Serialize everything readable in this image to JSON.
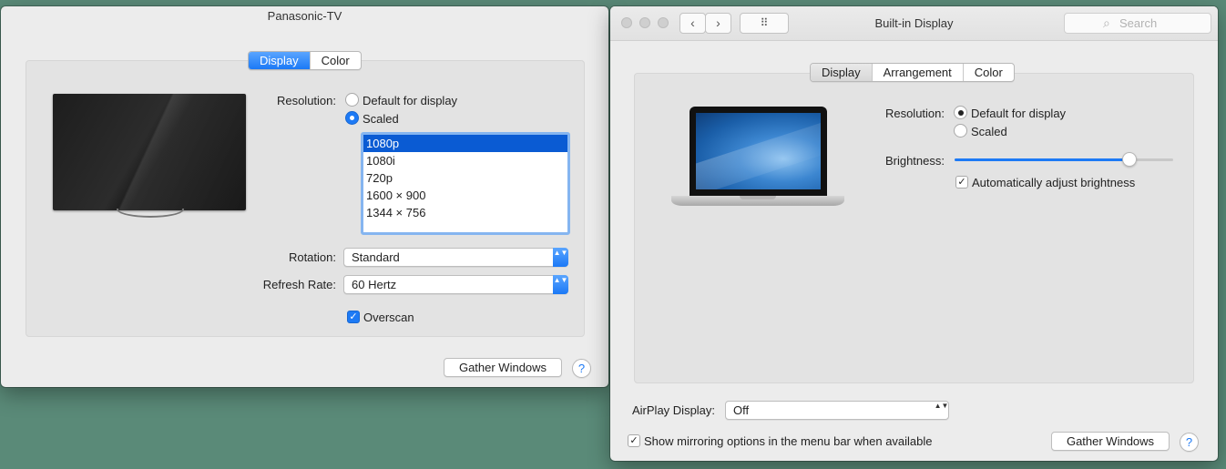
{
  "tv_window": {
    "title": "Panasonic-TV",
    "tabs": [
      {
        "label": "Display",
        "active": true
      },
      {
        "label": "Color",
        "active": false
      }
    ],
    "resolution_label": "Resolution:",
    "resolution_options": [
      {
        "label": "Default for display",
        "selected": false
      },
      {
        "label": "Scaled",
        "selected": true
      }
    ],
    "scaled_list": [
      {
        "label": "1080p",
        "selected": true
      },
      {
        "label": "1080i",
        "selected": false
      },
      {
        "label": "720p",
        "selected": false
      },
      {
        "label": "1600 × 900",
        "selected": false
      },
      {
        "label": "1344 × 756",
        "selected": false
      }
    ],
    "rotation_label": "Rotation:",
    "rotation_value": "Standard",
    "refresh_label": "Refresh Rate:",
    "refresh_value": "60 Hertz",
    "overscan_label": "Overscan",
    "overscan_checked": true,
    "gather_button": "Gather Windows",
    "help_glyph": "?"
  },
  "builtin_window": {
    "title": "Built-in Display",
    "search_placeholder": "Search",
    "grid_glyph": "⠿",
    "back_glyph": "‹",
    "forward_glyph": "›",
    "search_glyph": "⌕",
    "tabs": [
      {
        "label": "Display",
        "active": true
      },
      {
        "label": "Arrangement",
        "active": false
      },
      {
        "label": "Color",
        "active": false
      }
    ],
    "resolution_label": "Resolution:",
    "resolution_options": [
      {
        "label": "Default for display",
        "selected": true
      },
      {
        "label": "Scaled",
        "selected": false
      }
    ],
    "brightness_label": "Brightness:",
    "brightness_level": 0.8,
    "auto_brightness_label": "Automatically adjust brightness",
    "auto_brightness_checked": true,
    "airplay_label": "AirPlay Display:",
    "airplay_value": "Off",
    "mirroring_label": "Show mirroring options in the menu bar when available",
    "mirroring_checked": true,
    "gather_button": "Gather Windows",
    "help_glyph": "?"
  },
  "glyphs": {
    "check": "✓",
    "popup_arrows": "▲▼"
  },
  "colors": {
    "accent": "#1d7af5",
    "desktop": "#5a8a78",
    "window_bg": "#ececec"
  }
}
